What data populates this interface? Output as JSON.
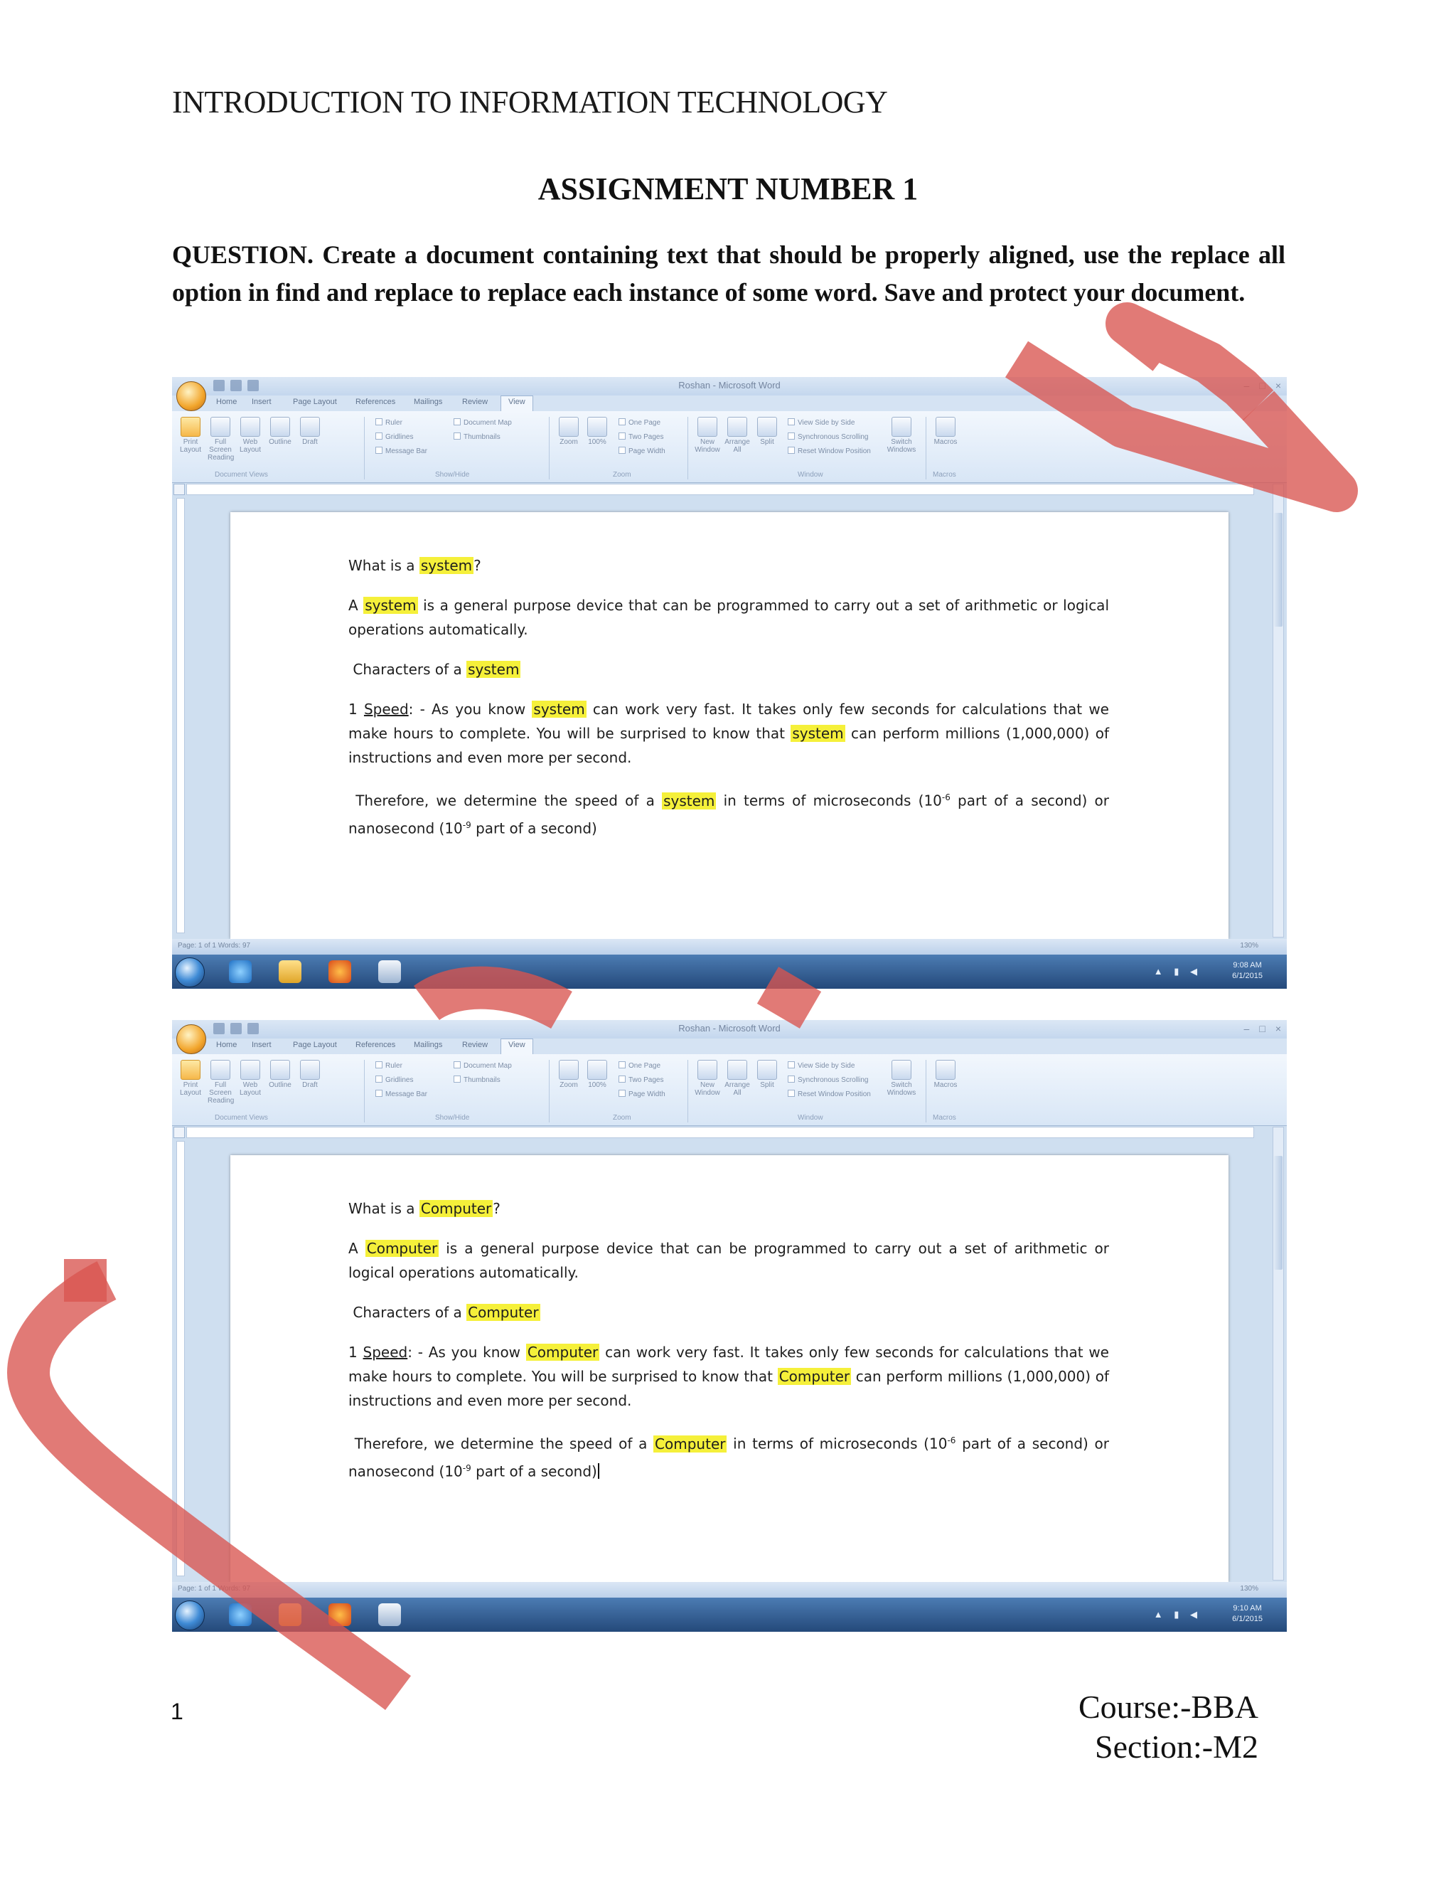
{
  "header": {
    "course_title": "INTRODUCTION TO INFORMATION TECHNOLOGY"
  },
  "assignment_title": "ASSIGNMENT NUMBER 1",
  "question": "QUESTION. Create a document containing text that should be properly aligned, use the replace all option in find and replace to replace each instance of some word. Save and protect your document.",
  "word_window": {
    "title": "Roshan - Microsoft Word",
    "tabs": [
      "Home",
      "Insert",
      "Page Layout",
      "References",
      "Mailings",
      "Review",
      "View"
    ],
    "active_tab": "View",
    "ribbon_views": [
      "Print Layout",
      "Full Screen Reading",
      "Web Layout",
      "Outline",
      "Draft"
    ],
    "ribbon_show_hide": [
      "Ruler",
      "Gridlines",
      "Message Bar",
      "Document Map",
      "Thumbnails"
    ],
    "ribbon_zoom": [
      "Zoom",
      "100%",
      "One Page",
      "Two Pages",
      "Page Width"
    ],
    "ribbon_window": [
      "New Window",
      "Arrange All",
      "Split",
      "View Side by Side",
      "Synchronous Scrolling",
      "Reset Window Position",
      "Switch Windows"
    ],
    "ribbon_macros": "Macros",
    "group_labels": [
      "Document Views",
      "Show/Hide",
      "Zoom",
      "Window",
      "Macros"
    ],
    "status_left": "Page: 1 of 1    Words: 97",
    "status_zoom": "130%"
  },
  "screenshot_before": {
    "heading_pre": "What is a ",
    "heading_word": "system",
    "heading_post": "?",
    "p1_pre": "A ",
    "p1_word": "system",
    "p1_post": " is a general purpose device that can be programmed to carry out a set of arithmetic or logical operations automatically.",
    "p2_pre": "Characters of a ",
    "p2_word": "system",
    "p3_num": "1 ",
    "p3_speed": "Speed",
    "p3_a": ": - As you know ",
    "p3_w1": "system",
    "p3_b": " can work very fast. It takes only few seconds for calculations that we make hours to complete. You will be surprised to know that ",
    "p3_w2": "system",
    "p3_c": " can perform millions (1,000,000) of instructions and even more per second.",
    "p4_a": "Therefore, we determine the speed of a ",
    "p4_word": "system",
    "p4_b": " in terms of microseconds (10",
    "p4_exp1": "-6",
    "p4_c": " part of a second) or nanosecond (10",
    "p4_exp2": "-9",
    "p4_d": " part of a second)",
    "clock_time": "9:08 AM",
    "clock_date": "6/1/2015"
  },
  "screenshot_after": {
    "heading_pre": "What is a ",
    "heading_word": "Computer",
    "heading_post": "?",
    "p1_pre": "A ",
    "p1_word": "Computer",
    "p1_post": " is a general purpose device that can be programmed to carry out a set of arithmetic or logical operations automatically.",
    "p2_pre": "Characters of a ",
    "p2_word": "Computer",
    "p3_num": "1 ",
    "p3_speed": "Speed",
    "p3_a": ": - As you know ",
    "p3_w1": "Computer",
    "p3_b": " can work very fast. It takes only few seconds for calculations that we make hours to complete. You will be surprised to know that ",
    "p3_w2": "Computer",
    "p3_c": " can perform millions (1,000,000) of instructions and even more per second.",
    "p4_a": "Therefore, we determine the speed of a ",
    "p4_word": "Computer",
    "p4_b": " in terms of microseconds (10",
    "p4_exp1": "-6",
    "p4_c": " part of a second) or nanosecond (10",
    "p4_exp2": "-9",
    "p4_d": " part of a second)",
    "clock_time": "9:10 AM",
    "clock_date": "6/1/2015"
  },
  "footer": {
    "page_number": "1",
    "course": "Course:-BBA",
    "section": "Section:-M2"
  },
  "colors": {
    "highlight": "#f5f03a",
    "watermark": "#d9544f"
  }
}
